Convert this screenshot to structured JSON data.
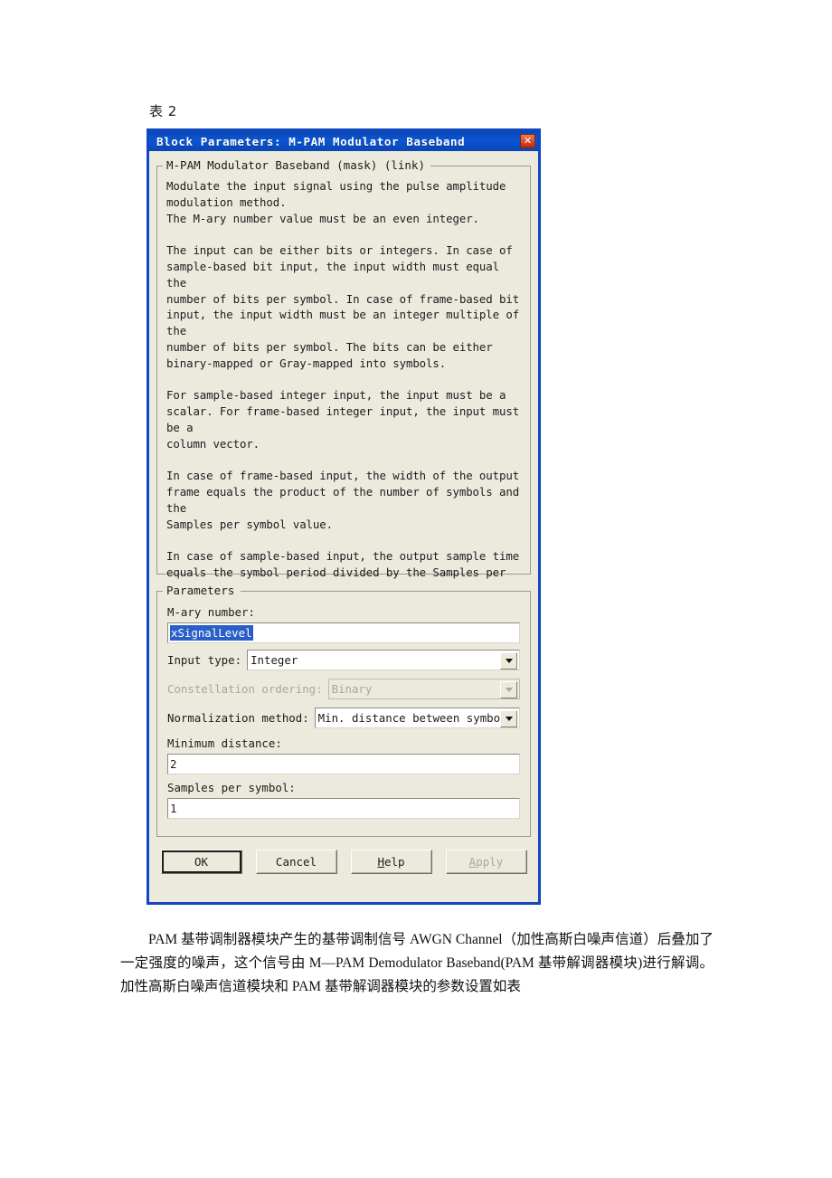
{
  "document": {
    "caption": "表 2",
    "paragraph": "PAM 基带调制器模块产生的基带调制信号 AWGN Channel（加性高斯白噪声信道）后叠加了一定强度的噪声，这个信号由 M—PAM Demodulator Baseband(PAM 基带解调器模块)进行解调。加性高斯白噪声信道模块和 PAM 基带解调器模块的参数设置如表"
  },
  "dialog": {
    "title": "Block Parameters: M-PAM Modulator Baseband",
    "close_label": "✕",
    "description_group": {
      "legend": "M-PAM Modulator Baseband (mask) (link)",
      "text": "Modulate the input signal using the pulse amplitude\nmodulation method.\nThe M-ary number value must be an even integer.\n\nThe input can be either bits or integers. In case of\nsample-based bit input, the input width must equal the\nnumber of bits per symbol. In case of frame-based bit\ninput, the input width must be an integer multiple of the\nnumber of bits per symbol. The bits can be either\nbinary-mapped or Gray-mapped into symbols.\n\nFor sample-based integer input, the input must be a\nscalar. For frame-based integer input, the input must be a\ncolumn vector.\n\nIn case of frame-based input, the width of the output\nframe equals the product of the number of symbols and the\nSamples per symbol value.\n\nIn case of sample-based input, the output sample time\nequals the symbol period divided by the Samples per symbol\nvalue."
    },
    "parameters_group": {
      "legend": "Parameters",
      "fields": {
        "mary_number": {
          "label": "M-ary number:",
          "value": "xSignalLevel",
          "selected": true
        },
        "input_type": {
          "label": "Input type:",
          "value": "Integer",
          "disabled": false
        },
        "constellation_ordering": {
          "label": "Constellation ordering:",
          "value": "Binary",
          "disabled": true
        },
        "normalization_method": {
          "label": "Normalization method:",
          "value": "Min. distance between symbols",
          "disabled": false
        },
        "minimum_distance": {
          "label": "Minimum distance:",
          "value": "2"
        },
        "samples_per_symbol": {
          "label": "Samples per symbol:",
          "value": "1"
        }
      }
    },
    "buttons": {
      "ok": "OK",
      "cancel": "Cancel",
      "help_prefix": "H",
      "help_rest": "elp",
      "apply_prefix": "A",
      "apply_rest": "pply"
    },
    "colors": {
      "titlebar": "#0b55d2",
      "face": "#ece9dd",
      "selection": "#2a5fc8",
      "close": "#d8442a"
    }
  }
}
